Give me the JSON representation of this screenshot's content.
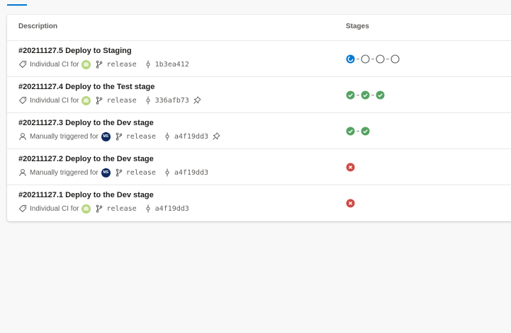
{
  "table": {
    "col_description": "Description",
    "col_stages": "Stages"
  },
  "runs": [
    {
      "title": "#20211127.5 Deploy to Staging",
      "trigger": "Individual CI for",
      "branch": "release",
      "commit": "1b3ea412",
      "pinned": false,
      "stages": [
        "running",
        "pending",
        "pending",
        "pending"
      ]
    },
    {
      "title": "#20211127.4 Deploy to the Test stage",
      "trigger": "Individual CI for",
      "branch": "release",
      "commit": "336afb73",
      "pinned": true,
      "stages": [
        "success",
        "success",
        "success"
      ]
    },
    {
      "title": "#20211127.3 Deploy to the Dev stage",
      "trigger": "Manually triggered for",
      "avatar_initials": "MS",
      "branch": "release",
      "commit": "a4f19dd3",
      "pinned": true,
      "stages": [
        "success",
        "success"
      ]
    },
    {
      "title": "#20211127.2 Deploy to the Dev stage",
      "trigger": "Manually triggered for",
      "avatar_initials": "MS",
      "branch": "release",
      "commit": "a4f19dd3",
      "pinned": false,
      "stages": [
        "failed"
      ]
    },
    {
      "title": "#20211127.1 Deploy to the Dev stage",
      "trigger": "Individual CI for",
      "branch": "release",
      "commit": "a4f19dd3",
      "pinned": false,
      "stages": [
        "failed"
      ]
    }
  ],
  "colors": {
    "accent": "#0078d4",
    "success": "#55a362",
    "failed": "#cd4a45",
    "running": "#0078d4",
    "pending": "#605e5c"
  }
}
